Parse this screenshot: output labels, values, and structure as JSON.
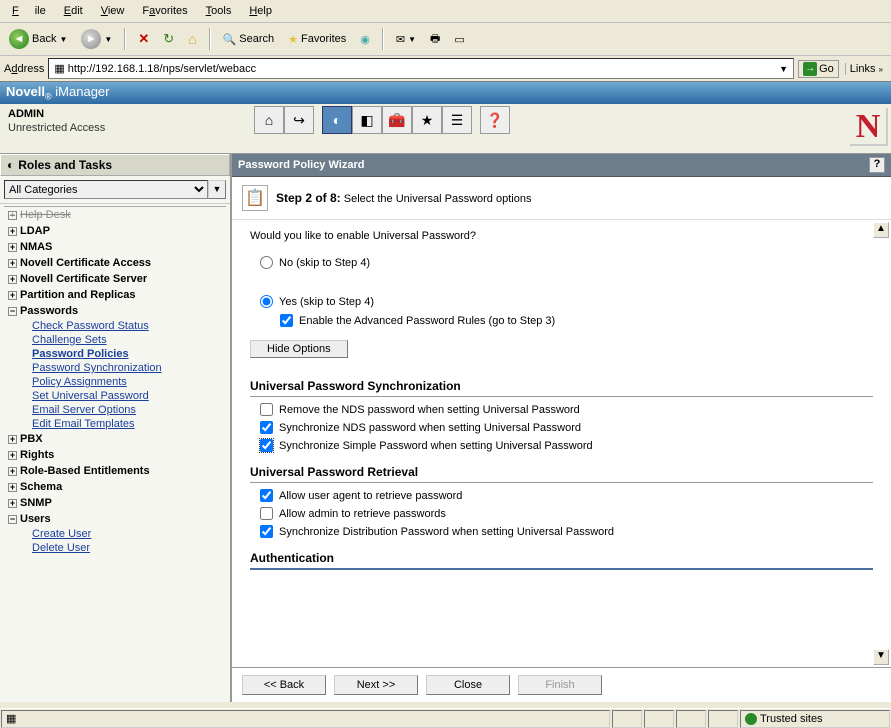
{
  "menu": {
    "file": "File",
    "edit": "Edit",
    "view": "View",
    "favorites": "Favorites",
    "tools": "Tools",
    "help": "Help"
  },
  "toolbar": {
    "back": "Back",
    "search": "Search",
    "favorites": "Favorites"
  },
  "address": {
    "label": "Address",
    "url": "http://192.168.1.18/nps/servlet/webacc",
    "go": "Go",
    "links": "Links"
  },
  "brand": {
    "name": "Novell",
    "sub": "iManager"
  },
  "admin": {
    "title": "ADMIN",
    "sub": "Unrestricted Access"
  },
  "roles": {
    "title": "Roles and Tasks",
    "category": "All Categories"
  },
  "tree": {
    "truncated": "Help Desk",
    "items": [
      "LDAP",
      "NMAS",
      "Novell Certificate Access",
      "Novell Certificate Server",
      "Partition and Replicas",
      "Passwords",
      "PBX",
      "Rights",
      "Role-Based Entitlements",
      "Schema",
      "SNMP",
      "Users"
    ],
    "passwords_children": [
      "Check Password Status",
      "Challenge Sets",
      "Password Policies",
      "Password Synchronization",
      "Policy Assignments",
      "Set Universal Password",
      "Email Server Options",
      "Edit Email Templates"
    ],
    "passwords_current": "Password Policies",
    "users_children": [
      "Create User",
      "Delete User"
    ]
  },
  "wizard": {
    "header": "Password Policy Wizard",
    "step_label": "Step 2 of 8:",
    "step_text": "Select the Universal Password options",
    "prompt": "Would you like to enable Universal Password?",
    "no_label": "No   (skip to Step 4)",
    "yes_label": "Yes   (skip to Step 4)",
    "adv_label": "Enable the Advanced Password Rules  (go to Step 3)",
    "hide_options": "Hide Options",
    "sync_head": "Universal Password Synchronization",
    "sync_opts": [
      "Remove the NDS password when setting Universal Password",
      "Synchronize NDS password when setting Universal Password",
      "Synchronize Simple Password when setting Universal Password"
    ],
    "retr_head": "Universal Password Retrieval",
    "retr_opts": [
      "Allow user agent to retrieve password",
      "Allow admin to retrieve passwords",
      "Synchronize Distribution Password when setting Universal Password"
    ],
    "auth_head": "Authentication",
    "back_btn": "<< Back",
    "next_btn": "Next >>",
    "close_btn": "Close",
    "finish_btn": "Finish"
  },
  "status": {
    "trusted": "Trusted sites"
  }
}
